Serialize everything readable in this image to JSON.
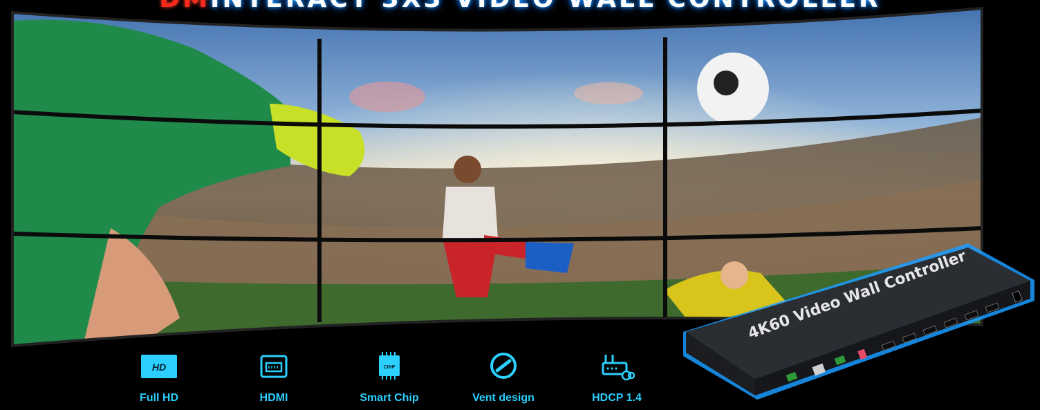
{
  "header": {
    "brand": "DM",
    "title": "INTERACT 3X3 VIDEO WALL CONTROLLER"
  },
  "hero": {
    "grid": "3x3",
    "image": "soccer-stadium-scene"
  },
  "features": [
    {
      "label": "Full HD",
      "icon": "hd-icon",
      "badge": "HD"
    },
    {
      "label": "HDMI",
      "icon": "hdmi-port-icon"
    },
    {
      "label": "Smart Chip",
      "icon": "chip-icon",
      "badge": "CHIP"
    },
    {
      "label": "Vent design",
      "icon": "vent-icon"
    },
    {
      "label": "HDCP 1.4",
      "icon": "hdcp-router-icon"
    }
  ],
  "device": {
    "label": "4K60 Video Wall Controller"
  },
  "colors": {
    "accent": "#2bd0ff",
    "brand": "#ff2a1a",
    "title_glow": "#2aa7ff",
    "device_edge": "#1a9bff"
  }
}
